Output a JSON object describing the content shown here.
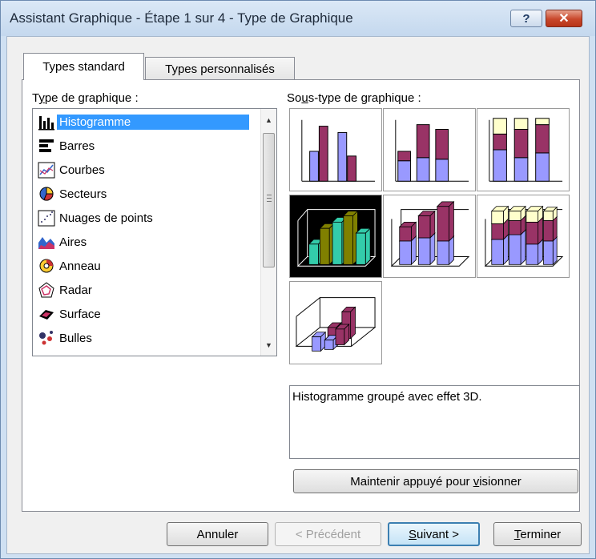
{
  "window": {
    "title": "Assistant Graphique - Étape 1 sur 4 - Type de Graphique",
    "help_label": "?",
    "close_label": "✕"
  },
  "tabs": [
    {
      "label": "Types standard",
      "active": true
    },
    {
      "label": "Types personnalisés",
      "active": false
    }
  ],
  "chart_type_label": "Type de graphique :",
  "chart_types": [
    {
      "label": "Histogramme",
      "icon": "column-chart-icon",
      "selected": true
    },
    {
      "label": "Barres",
      "icon": "bar-chart-icon"
    },
    {
      "label": "Courbes",
      "icon": "line-chart-icon"
    },
    {
      "label": "Secteurs",
      "icon": "pie-chart-icon"
    },
    {
      "label": "Nuages de points",
      "icon": "scatter-chart-icon"
    },
    {
      "label": "Aires",
      "icon": "area-chart-icon"
    },
    {
      "label": "Anneau",
      "icon": "doughnut-chart-icon"
    },
    {
      "label": "Radar",
      "icon": "radar-chart-icon"
    },
    {
      "label": "Surface",
      "icon": "surface-chart-icon"
    },
    {
      "label": "Bulles",
      "icon": "bubble-chart-icon"
    }
  ],
  "subtype_label": "Sous-type de graphique :",
  "subtypes": [
    {
      "name": "clustered-column",
      "selected": false
    },
    {
      "name": "stacked-column",
      "selected": false
    },
    {
      "name": "100-stacked-column",
      "selected": false
    },
    {
      "name": "3d-clustered-column",
      "selected": true
    },
    {
      "name": "3d-stacked-column",
      "selected": false
    },
    {
      "name": "3d-100-stacked-column",
      "selected": false
    },
    {
      "name": "3d-column",
      "selected": false
    }
  ],
  "description": "Histogramme groupé avec effet 3D.",
  "buttons": {
    "preview": {
      "pre": "Maintenir appuyé pour ",
      "ul": "v",
      "post": "isionner"
    },
    "cancel": "Annuler",
    "back": "< Précédent",
    "next": {
      "ul": "S",
      "post": "uivant >"
    },
    "finish": {
      "ul": "T",
      "post": "erminer"
    }
  },
  "colors": {
    "blue": "#9999ff",
    "maroon": "#993366",
    "cream": "#ffffcc",
    "teal": "#33ccaa",
    "olive": "#808000",
    "selection": "#3399ff"
  }
}
